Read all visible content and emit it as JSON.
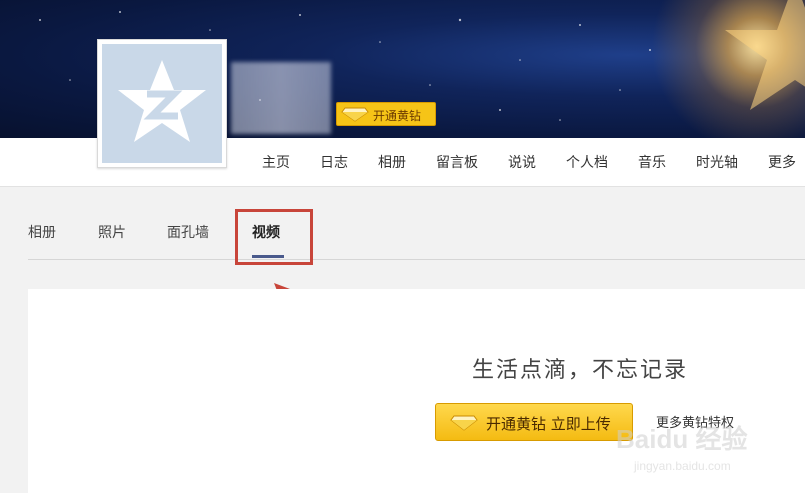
{
  "profile": {
    "vip_badge": "开通黄钻"
  },
  "nav": {
    "items": [
      "主页",
      "日志",
      "相册",
      "留言板",
      "说说",
      "个人档",
      "音乐",
      "时光轴",
      "更多"
    ]
  },
  "subtabs": {
    "items": [
      "相册",
      "照片",
      "面孔墙",
      "视频"
    ],
    "active": "视频"
  },
  "content": {
    "slogan": "生活点滴，不忘记录",
    "upload_button": "开通黄钻 立即上传",
    "more_privileges_link": "更多黄钻特权"
  },
  "watermark": {
    "brand": "Baidu 经验",
    "url": "jingyan.baidu.com"
  },
  "colors": {
    "banner": "#0a1840",
    "gold": "#f6c417",
    "annotation_red": "#c8453a"
  }
}
